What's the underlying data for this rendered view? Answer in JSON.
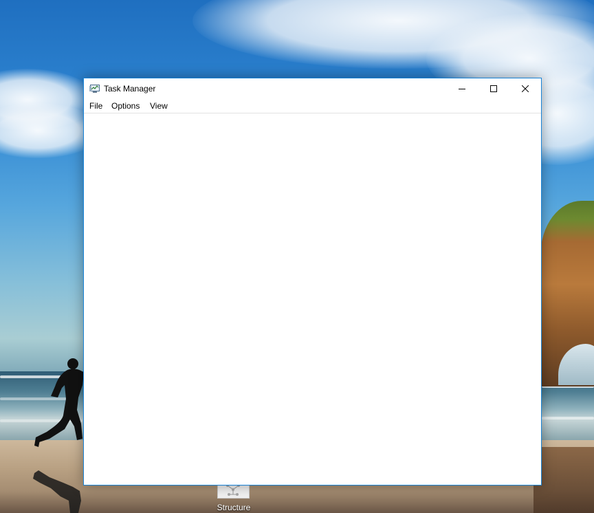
{
  "window": {
    "title": "Task Manager",
    "app_icon": "task-manager-icon",
    "border_color": "#1883d7",
    "caption_buttons": {
      "minimize_icon": "minimize-icon",
      "maximize_icon": "maximize-icon",
      "close_icon": "close-icon"
    }
  },
  "menu": {
    "items": [
      {
        "label": "File"
      },
      {
        "label": "Options"
      },
      {
        "label": "View"
      }
    ]
  },
  "desktop": {
    "icons": [
      {
        "label": "Structure",
        "icon": "structure-file-icon"
      }
    ]
  }
}
